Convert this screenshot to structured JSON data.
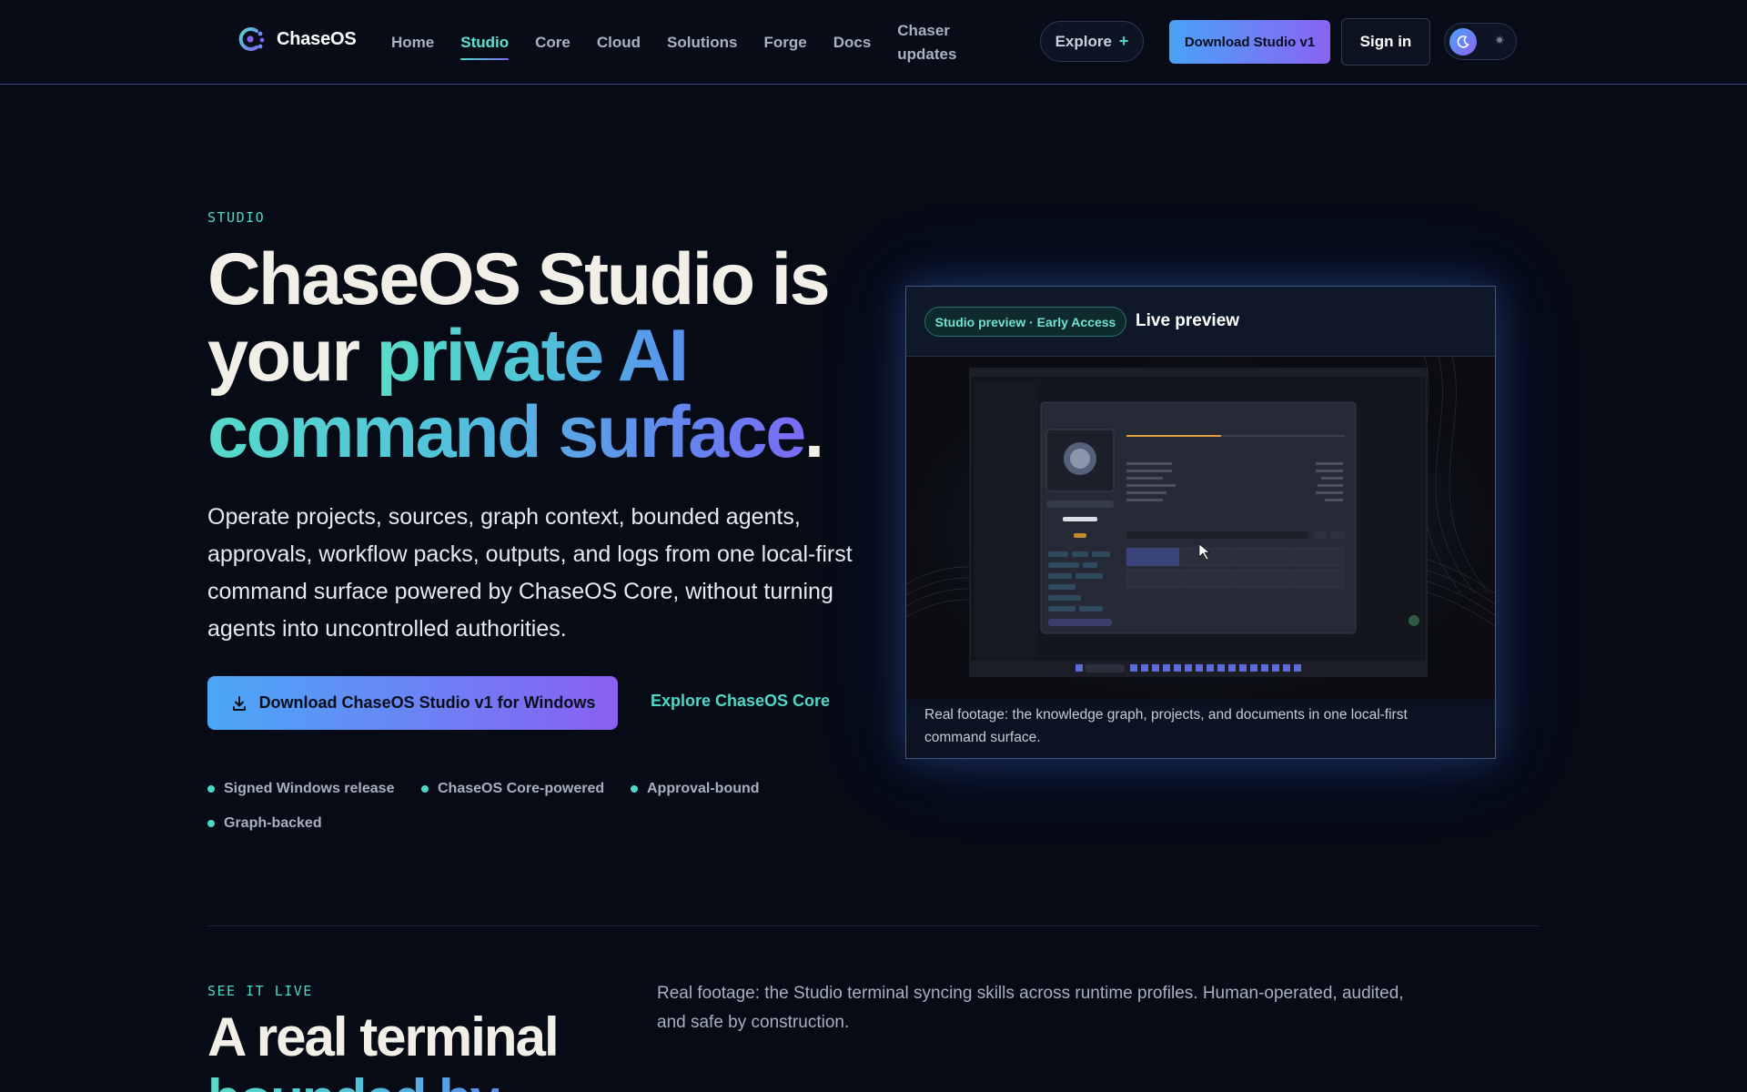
{
  "nav": {
    "brand": "ChaseOS",
    "links": [
      {
        "label": "Home"
      },
      {
        "label": "Studio"
      },
      {
        "label": "Core"
      },
      {
        "label": "Cloud"
      },
      {
        "label": "Solutions"
      },
      {
        "label": "Forge"
      },
      {
        "label": "Docs"
      },
      {
        "label": "Chaser updates"
      }
    ],
    "active": "Studio",
    "explore_label": "Explore",
    "download_label": "Download Studio v1",
    "signin_label": "Sign in"
  },
  "hero": {
    "eyebrow": "STUDIO",
    "title": {
      "part1": "ChaseOS Studio is your ",
      "highlight1": "private AI",
      "highlight2": "command surface",
      "end": "."
    },
    "description": "Operate projects, sources, graph context, bounded agents, approvals, workflow packs, outputs, and logs from one local-first command surface powered by ChaseOS Core, without turning agents into uncontrolled authorities.",
    "primary_cta": "Download ChaseOS Studio v1 for Windows",
    "secondary_cta": "Explore ChaseOS Core",
    "badges": [
      "Signed Windows release",
      "ChaseOS Core-powered",
      "Approval-bound",
      "Graph-backed"
    ]
  },
  "preview": {
    "pill": "Studio preview · Early Access",
    "title": "Live preview",
    "caption": "Real footage: the knowledge graph, projects, and documents in one local-first command surface."
  },
  "section2": {
    "eyebrow": "SEE IT LIVE",
    "title": "A real terminal",
    "title_line2": "bounded by",
    "description": "Real footage: the Studio terminal syncing skills across runtime profiles. Human-operated, audited, and safe by construction."
  },
  "colors": {
    "background": "#060b16",
    "accent_teal": "#4fd8c8",
    "accent_blue": "#4aa2f7",
    "accent_purple": "#8a63f3"
  },
  "icons": [
    "chaseos-logo-icon",
    "plus-icon",
    "moon-icon",
    "sun-icon",
    "download-icon"
  ]
}
